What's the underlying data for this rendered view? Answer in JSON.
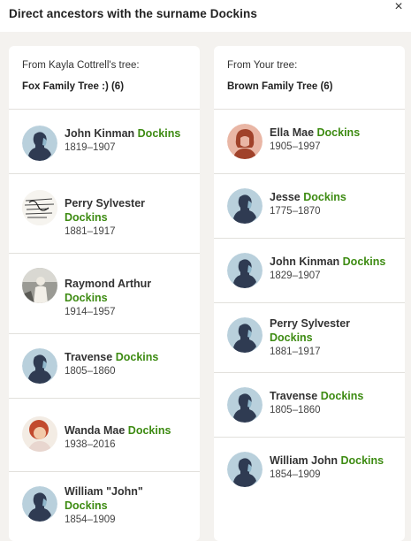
{
  "header": {
    "title": "Direct ancestors with the surname Dockins",
    "close_label": "×"
  },
  "colors": {
    "surname": "#3d8b12",
    "avatar_bg": "#b9d0dc",
    "avatar_silhouette": "#2f3b52"
  },
  "left": {
    "from": "From Kayla Cottrell's tree:",
    "tree": "Fox Family Tree :) (6)",
    "people": [
      {
        "first": "John Kinman",
        "last": "Dockins",
        "dates": "1819–1907",
        "avatar": "silhouette-icon"
      },
      {
        "first": "Perry Sylvester",
        "last": "Dockins",
        "dates": "1881–1917",
        "avatar": "document-photo"
      },
      {
        "first": "Raymond Arthur",
        "last": "Dockins",
        "dates": "1914–1957",
        "avatar": "person-photo"
      },
      {
        "first": "Travense",
        "last": "Dockins",
        "dates": "1805–1860",
        "avatar": "silhouette-icon"
      },
      {
        "first": "Wanda Mae",
        "last": "Dockins",
        "dates": "1938–2016",
        "avatar": "person-photo"
      },
      {
        "first": "William \"John\"",
        "last": "Dockins",
        "dates": "1854–1909",
        "avatar": "silhouette-icon"
      }
    ]
  },
  "right": {
    "from": "From Your tree:",
    "tree": "Brown Family Tree (6)",
    "people": [
      {
        "first": "Ella Mae",
        "last": "Dockins",
        "dates": "1905–1997",
        "avatar": "female-silhouette-icon"
      },
      {
        "first": "Jesse",
        "last": "Dockins",
        "dates": "1775–1870",
        "avatar": "silhouette-icon"
      },
      {
        "first": "John Kinman",
        "last": "Dockins",
        "dates": "1829–1907",
        "avatar": "silhouette-icon"
      },
      {
        "first": "Perry Sylvester",
        "last": "Dockins",
        "dates": "1881–1917",
        "avatar": "silhouette-icon"
      },
      {
        "first": "Travense",
        "last": "Dockins",
        "dates": "1805–1860",
        "avatar": "silhouette-icon"
      },
      {
        "first": "William John",
        "last": "Dockins",
        "dates": "1854–1909",
        "avatar": "silhouette-icon"
      }
    ]
  }
}
